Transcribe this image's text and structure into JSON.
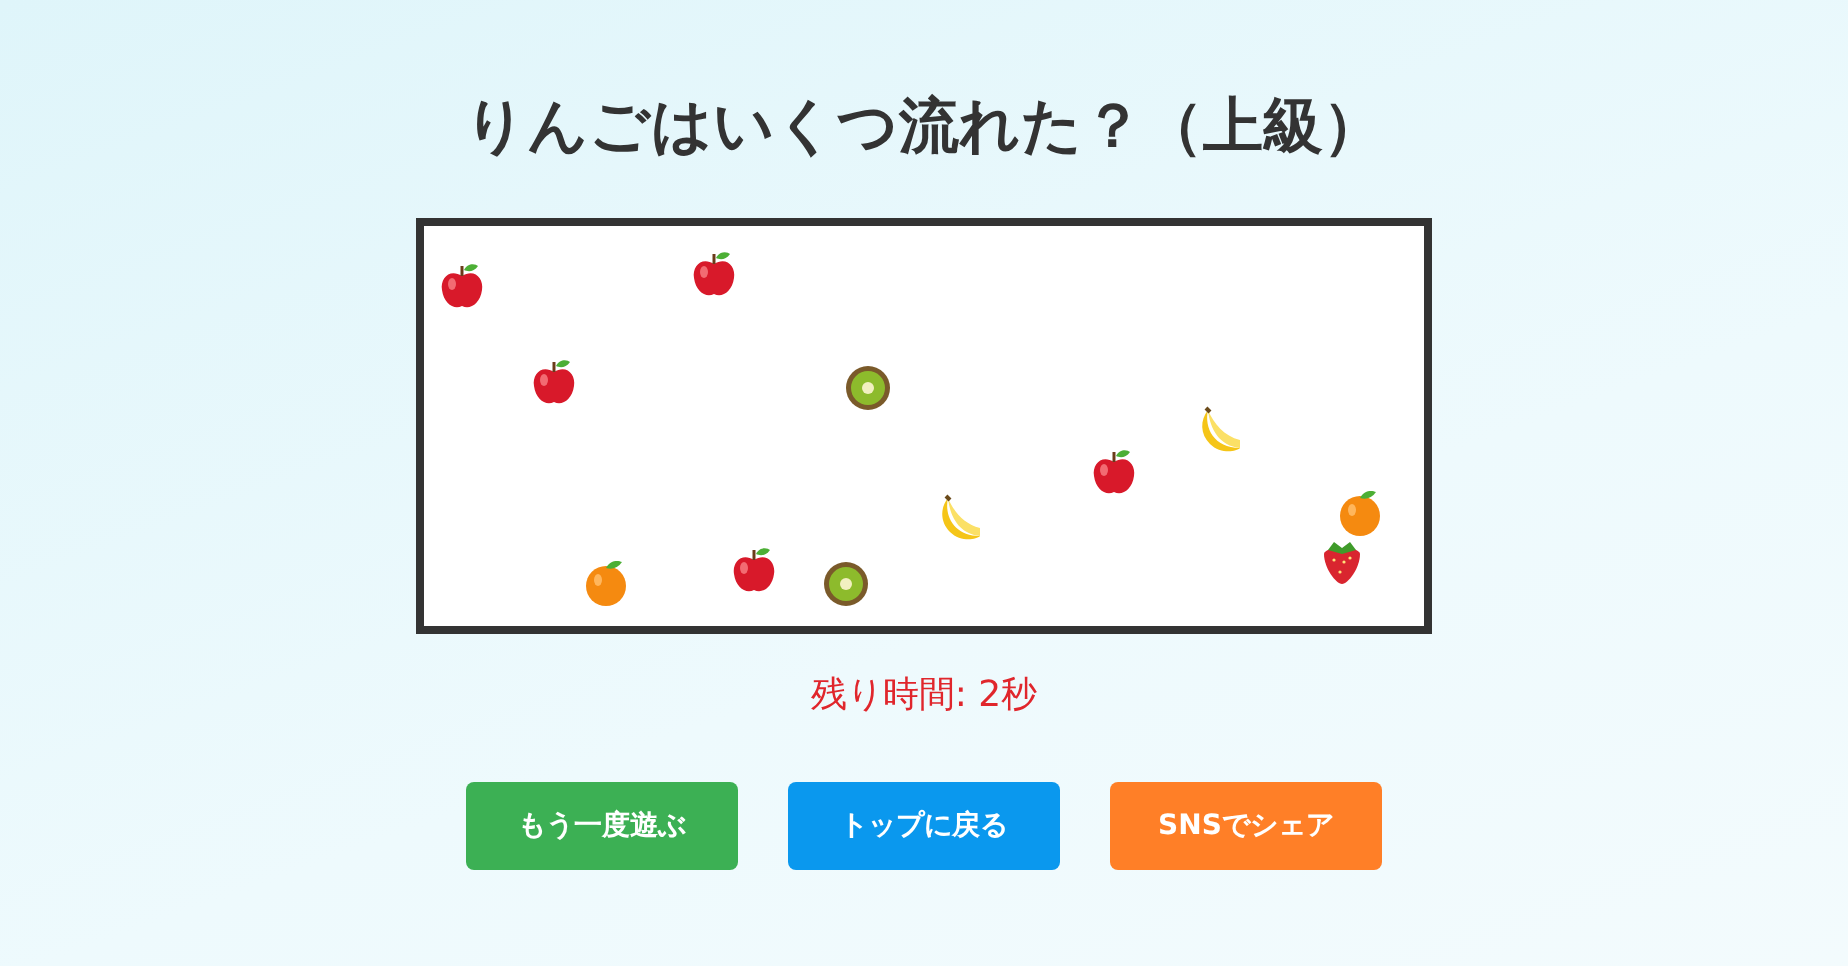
{
  "title": "りんごはいくつ流れた？（上級）",
  "timer": "残り時間: 2秒",
  "buttons": [
    {
      "label": "もう一度遊ぶ",
      "color": "#3cb054"
    },
    {
      "label": "トップに戻る",
      "color": "#0a98ee"
    },
    {
      "label": "SNSでシェア",
      "color": "#ff7f27"
    }
  ]
}
